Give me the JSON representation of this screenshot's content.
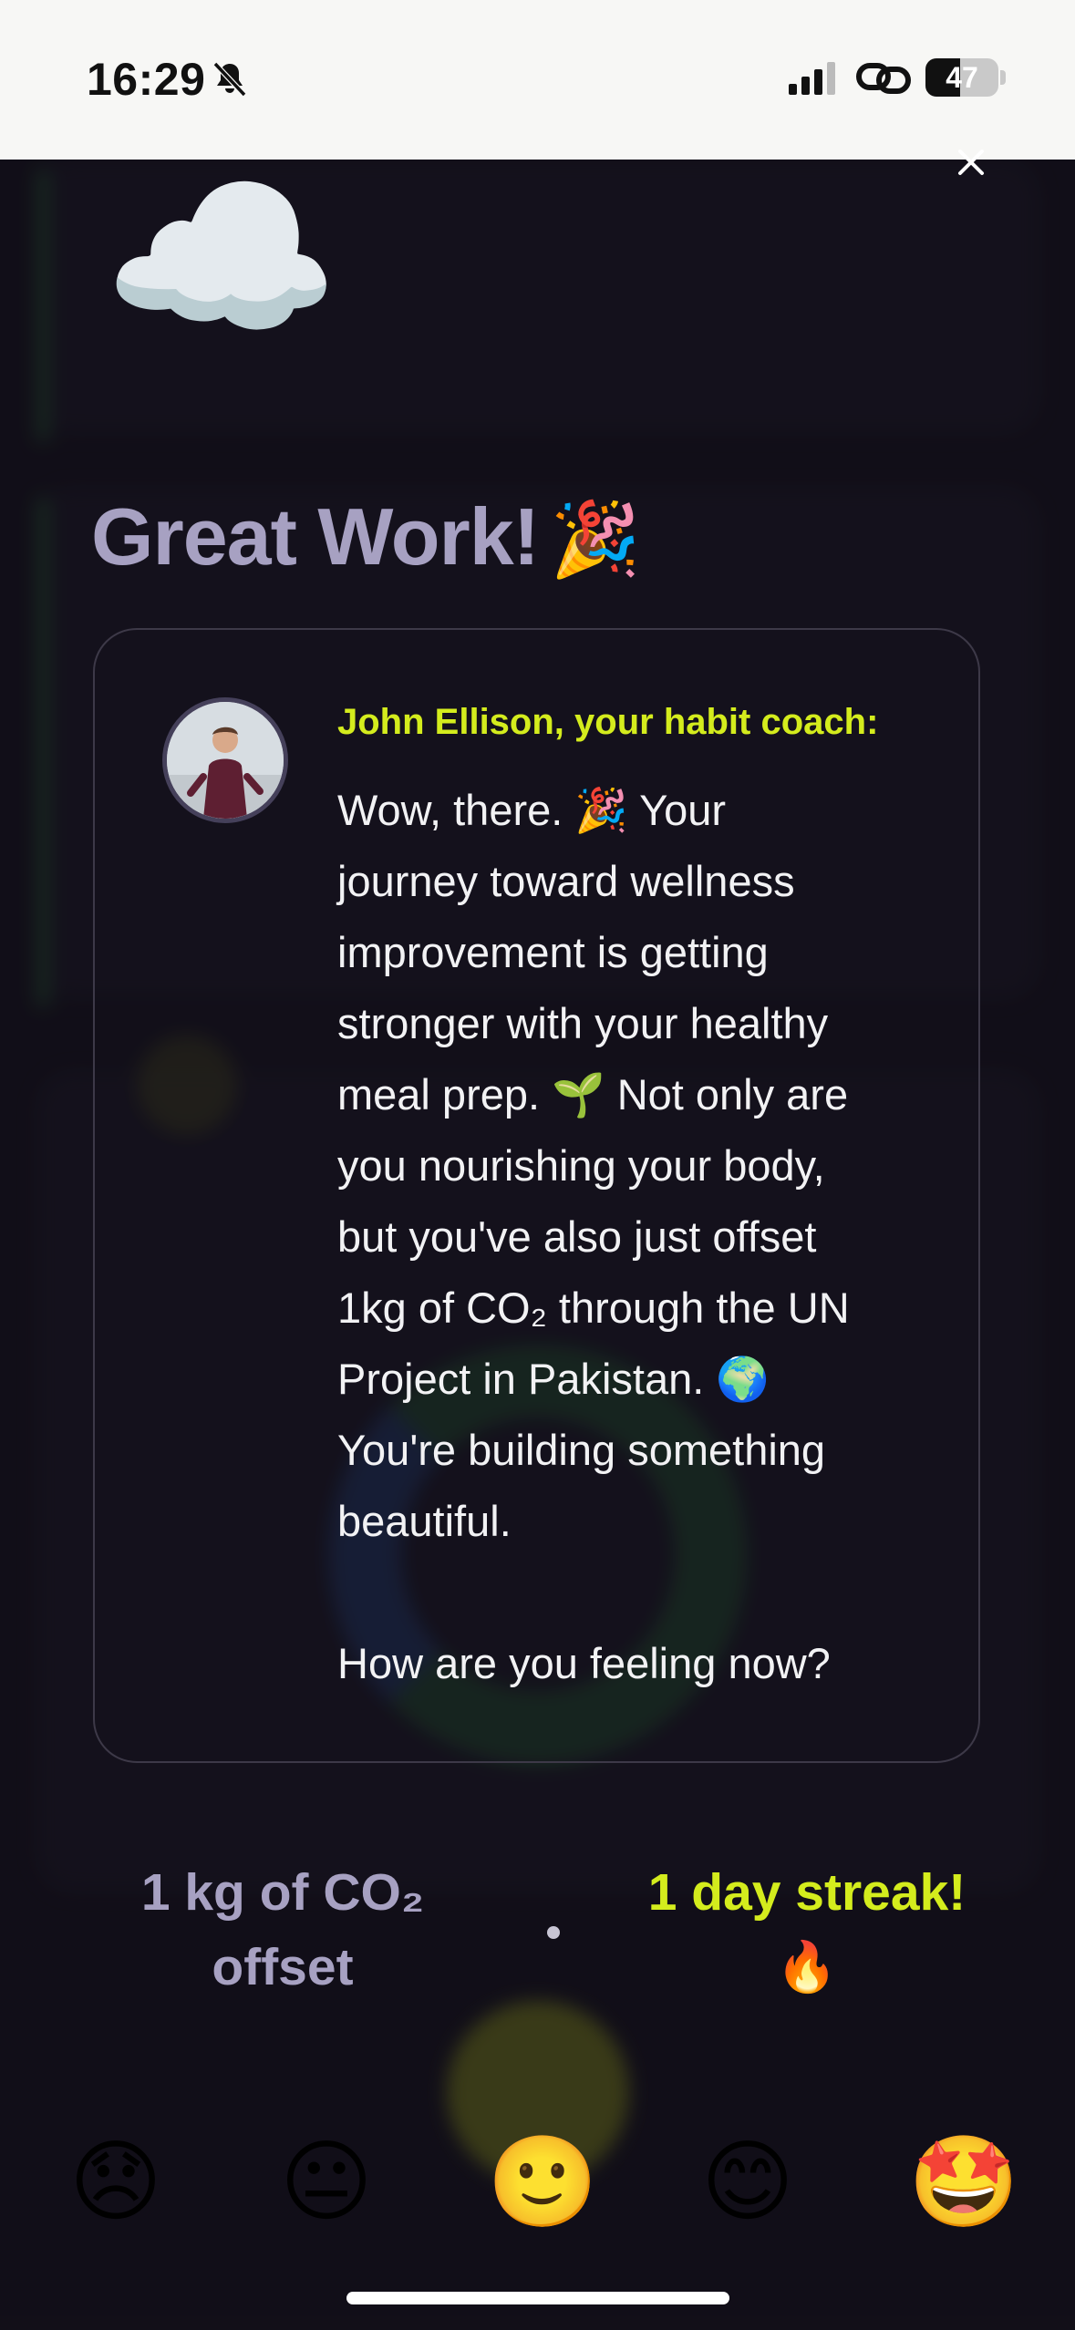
{
  "status_bar": {
    "time": "16:29",
    "battery_percent": "47",
    "icons": [
      "bell-slash-icon",
      "cellular-signal-icon",
      "link-icon",
      "battery-icon"
    ]
  },
  "modal": {
    "close_icon": "close-icon",
    "hero_emoji": "☁️",
    "title": "Great Work!",
    "title_emoji": "🎉",
    "coach_label": "John Ellison, your habit coach:",
    "message_lines": [
      "Wow, there. 🎉 Your",
      "journey toward wellness",
      "improvement is getting",
      "stronger with your healthy",
      "meal prep. 🌱 Not only are",
      "you nourishing your body,",
      "but you've also just offset",
      "1kg of CO₂ through the UN",
      "Project in Pakistan. 🌍",
      "You're building something",
      "beautiful."
    ],
    "question": "How are you feeling now?",
    "stats": {
      "offset_line1": "1 kg of CO₂",
      "offset_line2": "offset",
      "streak_line1": "1 day streak!",
      "streak_emoji": "🔥"
    },
    "moods": [
      {
        "name": "disappointed-face",
        "emoji": "😞"
      },
      {
        "name": "neutral-face",
        "emoji": "😐"
      },
      {
        "name": "slightly-smiling-face",
        "emoji": "🙂"
      },
      {
        "name": "smiling-face",
        "emoji": "😊"
      },
      {
        "name": "star-struck-face",
        "emoji": "🤩"
      }
    ]
  },
  "colors": {
    "background": "#15121c",
    "accent": "#d4ec1d",
    "title": "#a7a1c2",
    "card_border": "#3d3948"
  }
}
